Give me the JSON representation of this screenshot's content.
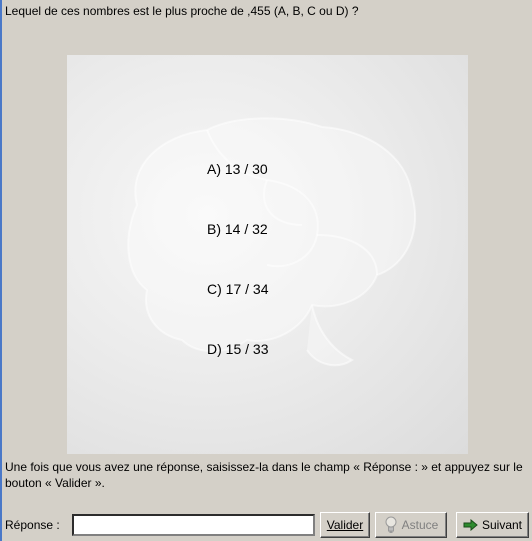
{
  "question": "Lequel de ces nombres est le plus proche de ,455 (A, B, C ou D) ?",
  "options": [
    {
      "label": "A) 13 / 30"
    },
    {
      "label": "B) 14 / 32"
    },
    {
      "label": "C) 17 / 34"
    },
    {
      "label": "D) 15 / 33"
    }
  ],
  "instructions": "Une fois que vous avez une réponse, saisissez-la dans le champ « Réponse : » et appuyez sur le bouton « Valider ».",
  "answer": {
    "label": "Réponse :",
    "value": ""
  },
  "buttons": {
    "valider": "Valider",
    "astuce": "Astuce",
    "suivant": "Suivant"
  },
  "icons": {
    "astuce": "lightbulb-icon",
    "suivant": "green-arrow-right-icon"
  },
  "colors": {
    "window_bg": "#d4d0c8",
    "arrow_green": "#2e8b2e"
  }
}
